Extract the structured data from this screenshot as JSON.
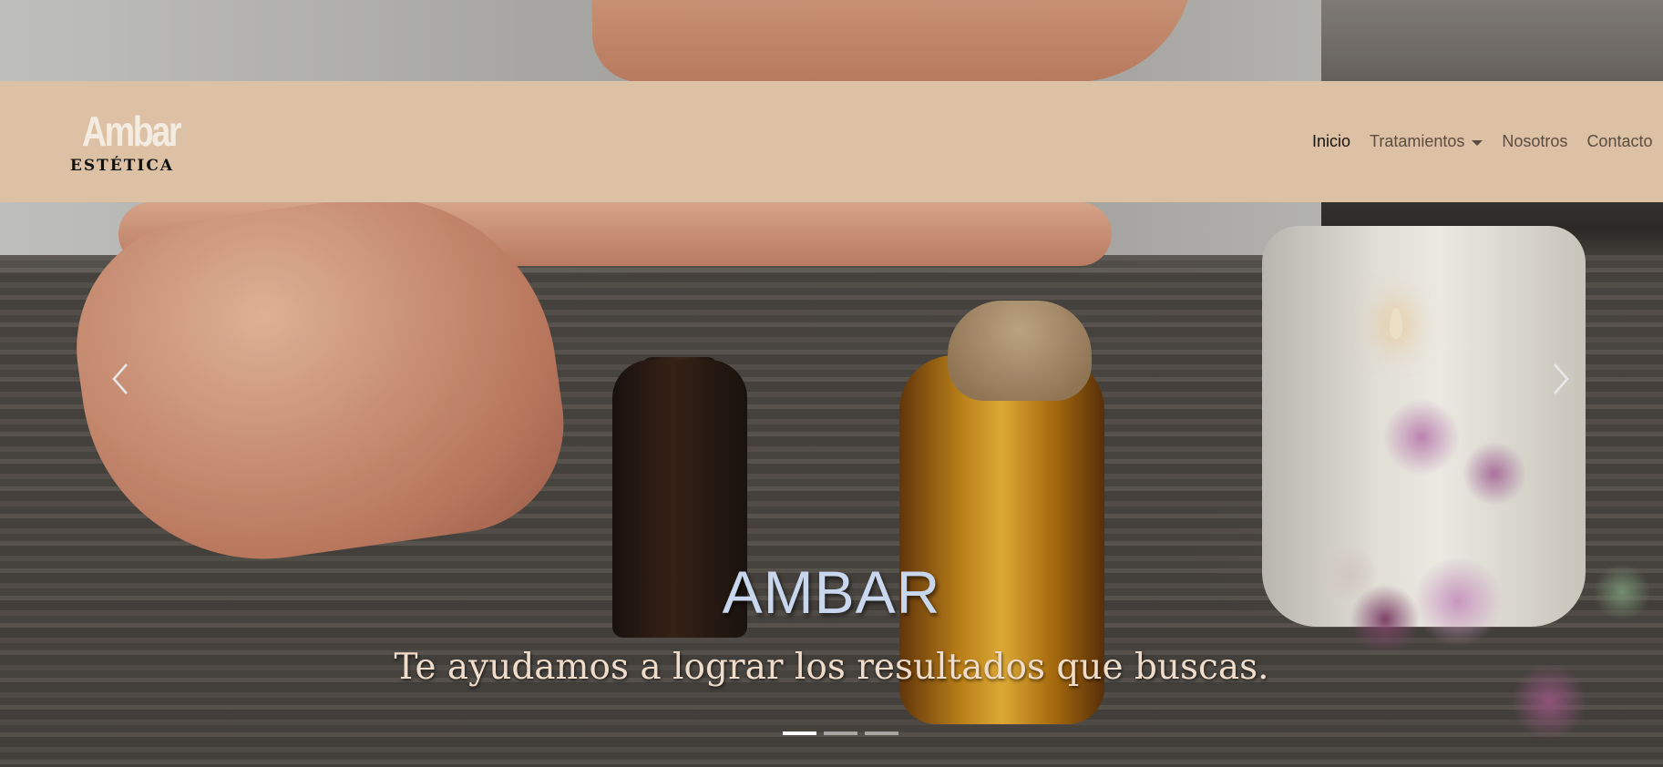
{
  "brand": {
    "name": "Ambar",
    "tagline": "ESTÉTICA"
  },
  "nav": {
    "items": [
      {
        "label": "Inicio",
        "active": true
      },
      {
        "label": "Tratamientos",
        "dropdown": true
      },
      {
        "label": "Nosotros"
      },
      {
        "label": "Contacto"
      }
    ]
  },
  "hero": {
    "title": "AMBAR",
    "subtitle": "Te ayudamos a lograr los resultados que buscas.",
    "slides_total": 3,
    "active_slide": 1
  },
  "icons": {
    "prev": "chevron-left-icon",
    "next": "chevron-right-icon",
    "dropdown": "caret-down-icon"
  },
  "colors": {
    "navbar_bg": "#dcc1a4",
    "title": "#c8d6ee",
    "subtitle": "#efdccb"
  }
}
